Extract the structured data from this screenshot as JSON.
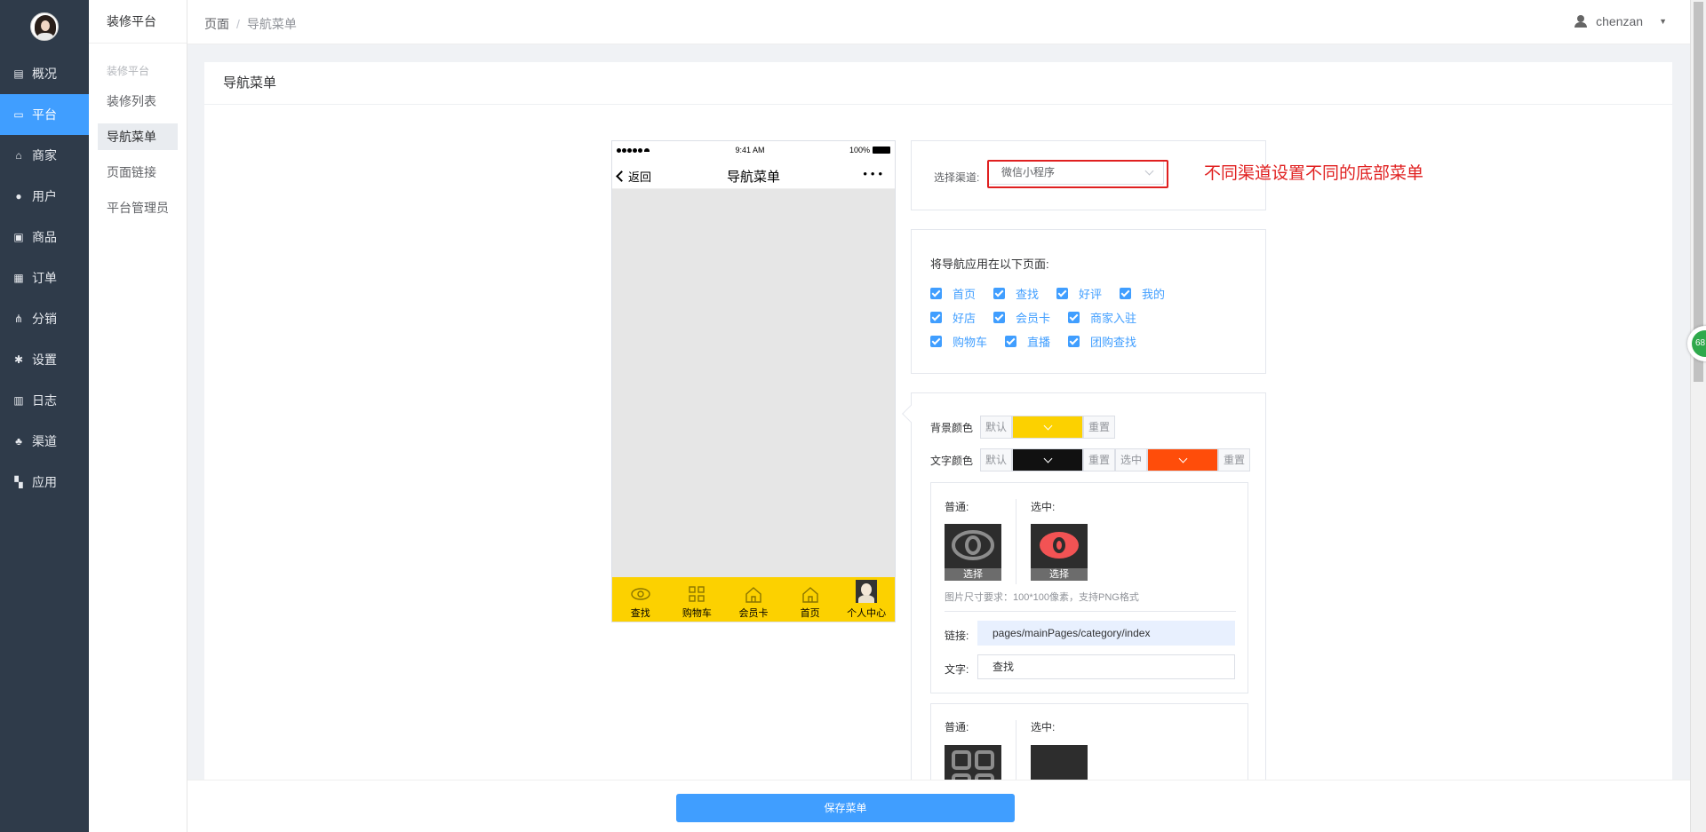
{
  "sidebar": {
    "items": [
      {
        "label": "概况",
        "icon": "dashboard-icon"
      },
      {
        "label": "平台",
        "icon": "monitor-icon",
        "active": true
      },
      {
        "label": "商家",
        "icon": "shop-icon"
      },
      {
        "label": "用户",
        "icon": "user-icon"
      },
      {
        "label": "商品",
        "icon": "goods-icon"
      },
      {
        "label": "订单",
        "icon": "order-icon"
      },
      {
        "label": "分销",
        "icon": "distribution-icon"
      },
      {
        "label": "设置",
        "icon": "gear-icon"
      },
      {
        "label": "日志",
        "icon": "log-icon"
      },
      {
        "label": "渠道",
        "icon": "channel-icon"
      },
      {
        "label": "应用",
        "icon": "apps-icon"
      }
    ]
  },
  "subbar": {
    "title": "装修平台",
    "group": "装修平台",
    "items": [
      "装修列表",
      "导航菜单",
      "页面链接",
      "平台管理员"
    ]
  },
  "header": {
    "breadcrumb": [
      "页面",
      "导航菜单"
    ],
    "user": "chenzan"
  },
  "card": {
    "title": "导航菜单"
  },
  "phone": {
    "time": "9:41 AM",
    "battery": "100%",
    "back": "返回",
    "title": "导航菜单",
    "more": "•••",
    "tabs": [
      "查找",
      "购物车",
      "会员卡",
      "首页",
      "个人中心"
    ]
  },
  "channel": {
    "label": "选择渠道:",
    "value": "微信小程序",
    "annotation": "不同渠道设置不同的底部菜单"
  },
  "pages": {
    "title": "将导航应用在以下页面:",
    "rows": [
      [
        "首页",
        "查找",
        "好评",
        "我的"
      ],
      [
        "好店",
        "会员卡",
        "商家入驻"
      ],
      [
        "购物车",
        "直播",
        "团购查找"
      ]
    ]
  },
  "style": {
    "bg_label": "背景颜色",
    "text_label": "文字颜色",
    "default": "默认",
    "reset": "重置",
    "selected": "选中",
    "bg_color": "#fcd100",
    "text_color": "#111111",
    "selected_color": "#ff4d0a"
  },
  "item1": {
    "normal": "普通:",
    "selected": "选中:",
    "choose": "选择",
    "hint": "图片尺寸要求：100*100像素，支持PNG格式",
    "link_label": "链接:",
    "link": "pages/mainPages/category/index",
    "text_label": "文字:",
    "text": "查找"
  },
  "item2": {
    "normal": "普通:",
    "selected": "选中:"
  },
  "footer": {
    "save": "保存菜单"
  },
  "float_badge": "68"
}
